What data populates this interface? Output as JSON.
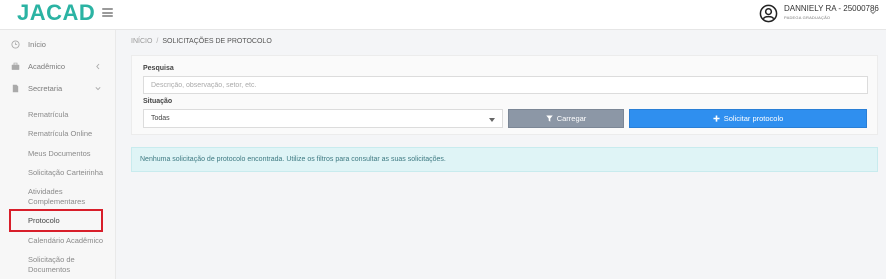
{
  "header": {
    "logo_text": "JACAD",
    "user_name": "DANNIELY RA - 25000786",
    "user_subtitle": "PADEGA GRADUAÇÃO"
  },
  "sidebar": {
    "items": [
      {
        "label": "Início",
        "icon": "clock-icon"
      },
      {
        "label": "Acadêmico",
        "icon": "briefcase-icon"
      },
      {
        "label": "Secretaria",
        "icon": "document-icon"
      }
    ],
    "subitems": [
      {
        "label": "Rematrícula"
      },
      {
        "label": "Rematrícula Online"
      },
      {
        "label": "Meus Documentos"
      },
      {
        "label": "Solicitação Carteirinha"
      },
      {
        "label": "Atividades Complementares"
      },
      {
        "label": "Protocolo"
      },
      {
        "label": "Calendário Acadêmico"
      },
      {
        "label": "Solicitação de Documentos"
      }
    ],
    "active_subitem": "Protocolo"
  },
  "breadcrumb": {
    "root": "INÍCIO",
    "separator": "/",
    "current": "SOLICITAÇÕES DE PROTOCOLO"
  },
  "filters": {
    "search_label": "Pesquisa",
    "search_value": "",
    "search_placeholder": "Descrição, observação, setor, etc.",
    "status_label": "Situação",
    "status_selected": "Todas",
    "load_button": "Carregar",
    "request_button": "Solicitar protocolo"
  },
  "alert": {
    "message": "Nenhuma solicitação de protocolo encontrada. Utilize os filtros para consultar as suas solicitações."
  },
  "colors": {
    "brand": "#2bb3a3",
    "primary_button": "#2f8fef",
    "secondary_button": "#8c97a6",
    "alert_bg": "#dff4f6",
    "highlight": "#d81e2a"
  }
}
